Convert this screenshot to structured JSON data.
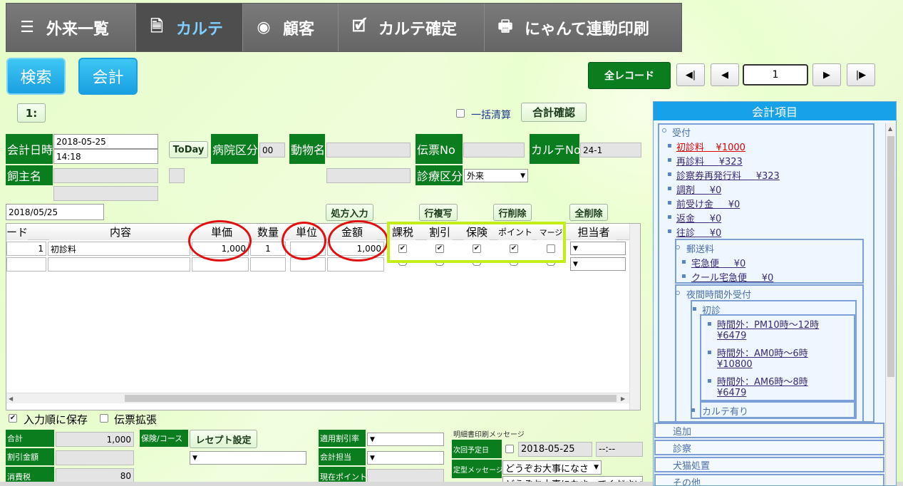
{
  "nav": [
    {
      "icon": "☰",
      "label": "外来一覧"
    },
    {
      "icon": "🗎",
      "label": "カルテ"
    },
    {
      "icon": "◉",
      "label": "顧客"
    },
    {
      "icon": "🗹",
      "label": "カルテ確定"
    },
    {
      "icon": "🖶",
      "label": "にゃんて連動印刷"
    }
  ],
  "buttons": {
    "search": "検索",
    "accounting": "会計",
    "all_records": "全レコード",
    "first": "◀|",
    "prev": "◀",
    "next": "▶",
    "last": "|▶",
    "page": "1",
    "tab1": "1:",
    "bulk_settle": "一括清算",
    "total_confirm": "合計確認",
    "today": "ToDay",
    "prescription": "処方入力",
    "copy_row": "行複写",
    "delete_row": "行削除",
    "delete_all": "全削除",
    "receipt": "レセプト設定"
  },
  "header": {
    "account_date_label": "会計日時",
    "account_date": "2018-05-25",
    "account_time": "14:18",
    "hospital_label": "病院区分",
    "hospital_value": "00",
    "animal_label": "動物名",
    "slip_label": "伝票No",
    "chart_label": "カルテNo",
    "chart_value": "24-1",
    "owner_label": "飼主名",
    "treatment_label": "診療区分",
    "treatment_value": "外来",
    "date_field": "2018/05/25"
  },
  "grid": {
    "headers": {
      "code": "ード",
      "content": "内容",
      "unit_price": "単価",
      "qty": "数量",
      "unit": "単位",
      "amount": "金額",
      "tax": "課税",
      "discount": "割引",
      "insurance": "保険",
      "point": "ポイント",
      "margin": "マージ",
      "staff": "担当者"
    },
    "rows": [
      {
        "code": "1",
        "content": "初診料",
        "unit_price": "1,000",
        "qty": "1",
        "unit": "",
        "amount": "1,000"
      }
    ]
  },
  "footer": {
    "save_order": "入力順に保存",
    "slip_expand": "伝票拡張",
    "total_label": "合計",
    "total_value": "1,000",
    "discount_label": "割引金額",
    "discount_value": "",
    "tax_label": "消費税",
    "tax_value": "80",
    "insurance_label": "保険/コース",
    "rate_label": "適用割引率",
    "staff_label": "会計担当",
    "point_label": "現在ポイント",
    "print_msg_label": "明細書印刷メッセージ",
    "next_date_label": "次回予定日",
    "next_date": "2018-05-25",
    "next_time": "--:--",
    "fixed_msg_label": "定型メッセージ",
    "fixed_msg": "どうぞお大事になさ",
    "msg_text": "どうぞお大事になさってください"
  },
  "panel": {
    "title": "会計項目",
    "reception": "受付",
    "items": [
      {
        "label": "初診料",
        "price": "¥1000"
      },
      {
        "label": "再診料",
        "price": "¥323"
      },
      {
        "label": "診察券再発行料",
        "price": "¥323"
      },
      {
        "label": "調剤",
        "price": "¥0"
      },
      {
        "label": "前受け金",
        "price": "¥0"
      },
      {
        "label": "返金",
        "price": "¥0"
      },
      {
        "label": "往診",
        "price": "¥0"
      }
    ],
    "postage": "郵送料",
    "postage_items": [
      {
        "label": "宅急便",
        "price": "¥0"
      },
      {
        "label": "クール宅急便",
        "price": "¥0"
      }
    ],
    "night": "夜間時間外受付",
    "first_visit": "初診",
    "night_items": [
      {
        "label": "時間外：PM10時～12時",
        "price": "¥6479"
      },
      {
        "label": "時間外：AM0時～6時",
        "price": "¥10800"
      },
      {
        "label": "時間外：AM6時～8時",
        "price": "¥6479"
      }
    ],
    "chart_exists": "カルテ有り",
    "sections": [
      "追加",
      "診察",
      "犬猫処置",
      "その他"
    ]
  },
  "colors": {
    "accent_green": "#0a7d1e",
    "accent_blue": "#17a1e8",
    "highlight": "#c4ee1a",
    "annotation": "#e01010"
  }
}
